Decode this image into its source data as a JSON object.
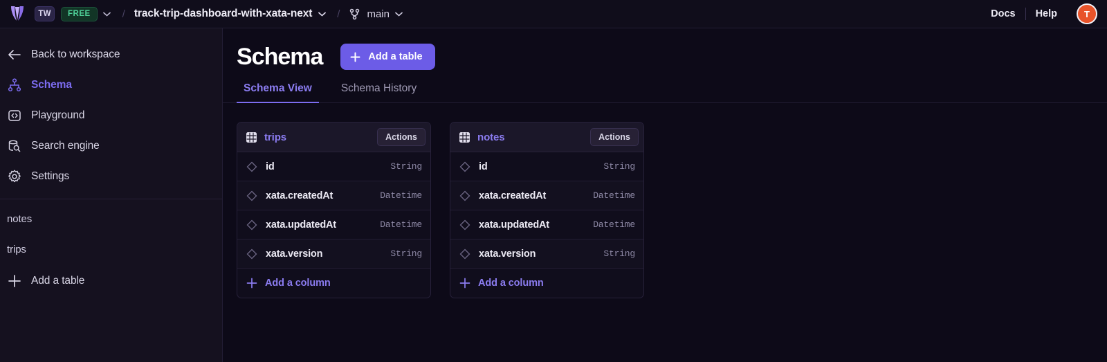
{
  "topbar": {
    "logo_icon": "xata-butterfly-logo",
    "workspace_initials": "TW",
    "plan_badge": "FREE",
    "separator": "/",
    "database_name": "track-trip-dashboard-with-xata-next",
    "branch_icon": "git-branch-icon",
    "branch_name": "main",
    "docs_label": "Docs",
    "help_label": "Help",
    "avatar_initial": "T"
  },
  "sidebar": {
    "back_label": "Back to workspace",
    "items": [
      {
        "label": "Schema",
        "icon": "schema-hierarchy-icon",
        "active": true
      },
      {
        "label": "Playground",
        "icon": "code-brackets-icon",
        "active": false
      },
      {
        "label": "Search engine",
        "icon": "database-search-icon",
        "active": false
      },
      {
        "label": "Settings",
        "icon": "gear-icon",
        "active": false
      }
    ],
    "tables": [
      "notes",
      "trips"
    ],
    "add_table_label": "Add a table"
  },
  "main": {
    "page_title": "Schema",
    "add_table_button": "Add a table",
    "tabs": [
      {
        "label": "Schema View",
        "active": true
      },
      {
        "label": "Schema History",
        "active": false
      }
    ],
    "cards": [
      {
        "name": "trips",
        "actions_label": "Actions",
        "add_column_label": "Add a column",
        "columns": [
          {
            "name": "id",
            "type": "String"
          },
          {
            "name": "xata.createdAt",
            "type": "Datetime"
          },
          {
            "name": "xata.updatedAt",
            "type": "Datetime"
          },
          {
            "name": "xata.version",
            "type": "String"
          }
        ]
      },
      {
        "name": "notes",
        "actions_label": "Actions",
        "add_column_label": "Add a column",
        "columns": [
          {
            "name": "id",
            "type": "String"
          },
          {
            "name": "xata.createdAt",
            "type": "Datetime"
          },
          {
            "name": "xata.updatedAt",
            "type": "Datetime"
          },
          {
            "name": "xata.version",
            "type": "String"
          }
        ]
      }
    ]
  },
  "colors": {
    "accent": "#6c5ce7",
    "accent_text": "#8b7cf0",
    "page_bg": "#0d0a18",
    "sidebar_bg": "#15111f",
    "plan_green": "#4fd199",
    "avatar_orange": "#e8532a"
  }
}
